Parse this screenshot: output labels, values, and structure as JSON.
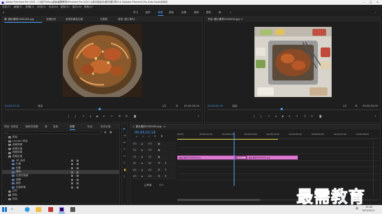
{
  "titlebar": {
    "title": "Adobe Premiere Pro 2020 - C:\\用户\\Vibu\\桌面\\最需教育\\Premiere Pro 2020 从新手到高手\\素材\\第2章\\2.4.5\\Adobe Premiere Pro Auto-Save\\未命名",
    "controls": [
      "—",
      "□",
      "×"
    ]
  },
  "menubar": {
    "items": [
      "文件(F)",
      "编辑(E)",
      "剪辑(C)",
      "序列(S)",
      "标记(M)",
      "图形(G)",
      "窗口(W)",
      "帮助(H)"
    ]
  },
  "workspaces": {
    "items": [
      "学习",
      "组件",
      "编辑",
      "颜色",
      "效果",
      "音频",
      "图形",
      "库"
    ],
    "active_index": 2
  },
  "source_monitor": {
    "tabs": [
      "源: 图片素材1000000.jpg",
      "效果控件",
      "音频剪辑混合器",
      "元数据",
      "音频: 图片素材..."
    ],
    "timecode": "00;00;07;01",
    "fit": "适合",
    "zoom": "1/2",
    "duration": "00;00;00;00"
  },
  "program_monitor": {
    "tabs": [
      "节目: 图片素材1000000.jpg"
    ],
    "timecode": "00;00;02;16",
    "fit": "适合",
    "zoom": "1/2",
    "duration": "00;00;00;00"
  },
  "project_panel": {
    "tabs": [
      "项目: 未命名",
      "媒体浏览器",
      "库",
      "信息",
      "效果",
      "标记",
      "历史记录"
    ],
    "active_tab": 4,
    "items": [
      {
        "label": "预设",
        "indent": 1
      },
      {
        "label": "Lumetri 预设",
        "indent": 1
      },
      {
        "label": "音频效果",
        "indent": 1
      },
      {
        "label": "音频过渡",
        "indent": 1
      },
      {
        "label": "视频效果",
        "indent": 1
      },
      {
        "label": "视频过渡",
        "indent": 1
      },
      {
        "label": "3D 运动",
        "indent": 2
      },
      {
        "label": "内滑",
        "indent": 2
      },
      {
        "label": "划像",
        "indent": 2
      },
      {
        "label": "擦除",
        "indent": 2,
        "selected": true
      },
      {
        "label": "沉浸式视频",
        "indent": 2
      },
      {
        "label": "溶解",
        "indent": 2
      },
      {
        "label": "缩放",
        "indent": 2
      },
      {
        "label": "页面剥落",
        "indent": 2
      },
      {
        "label": "过时",
        "indent": 1
      },
      {
        "label": "颜色",
        "indent": 1
      },
      {
        "label": "预设",
        "indent": 1
      }
    ]
  },
  "timeline": {
    "tab": "图片素材1000000.jpg",
    "timecode": "00;00;02;16",
    "ruler_labels": [
      "00;00",
      "00;00;01;00",
      "00;00;02;00",
      "00;00;03;00",
      "00;00;04;00",
      "00;00;05;00",
      "00;00;06;00",
      "00;00;07;00",
      "00;00;08;00"
    ],
    "tracks": [
      {
        "name": "V3"
      },
      {
        "name": "V2"
      },
      {
        "name": "V1"
      },
      {
        "name": "A1"
      },
      {
        "name": "A2"
      },
      {
        "name": "A3"
      }
    ],
    "master_label": "主声道",
    "master_value": "0.0",
    "clips": [
      {
        "label": "图片素材1000000.jpg",
        "start_sec": 0,
        "end_sec": 2.6
      },
      {
        "label": "交叉溶解",
        "start_sec": 2.6,
        "end_sec": 3.1,
        "transition": true
      },
      {
        "label": "图片素材1000000.jpg",
        "start_sec": 3.1,
        "end_sec": 5.4
      }
    ],
    "playhead_sec": 2.53
  },
  "taskbar": {
    "clock_time": "15:40",
    "clock_date": "2021/10/11",
    "lang": "英"
  },
  "watermark": {
    "text": "最需教育"
  },
  "colors": {
    "accent": "#4a9ff5",
    "clip": "#dc7ed3",
    "panel": "#1e1e1e",
    "work_bar": "#d8d040"
  }
}
